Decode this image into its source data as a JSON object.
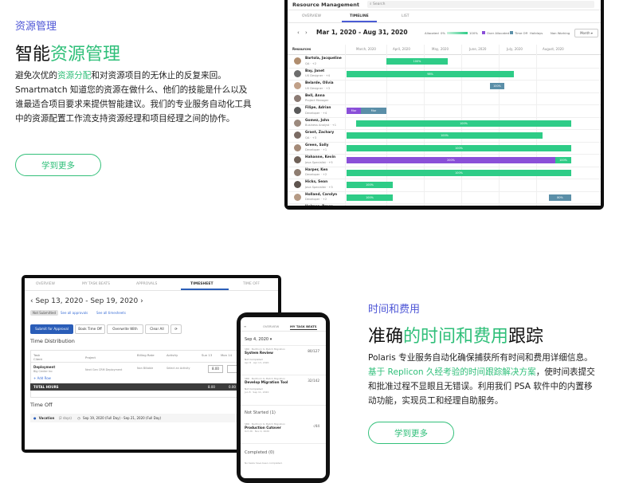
{
  "section1": {
    "label": "资源管理",
    "heading_pre": "智能",
    "heading_accent": "资源管理",
    "body_1": "避免次优的",
    "body_link": "资源分配",
    "body_2": "和对资源项目的无休止的反复来回。Smartmatch 知道您的资源在做什么、他们的技能是什么以及谁最适合项目要求来提供智能建议。我们的专业服务自动化工具中的资源配置工作流支持资源经理和项目经理之间的协作。",
    "button": "学到更多"
  },
  "section2": {
    "label": "时间和费用",
    "heading_pre": "准确",
    "heading_accent": "的时间和费用",
    "heading_post": "跟踪",
    "body_1": "Polaris 专业服务自动化确保捕获所有时间和费用详细信息。",
    "body_link": "基于 Replicon 久经考验的时间跟踪解决方案",
    "body_2": "，使时间表提交和批准过程不显眼且无错误。利用我们 PSA 软件中的内置移动功能，实现员工和经理自助服务。",
    "button": "学到更多"
  },
  "resource_app": {
    "title": "Resource Management",
    "search_placeholder": "Search",
    "tabs": [
      "OVERVIEW",
      "TIMELINE",
      "LIST"
    ],
    "date_range": "Mar 1, 2020 - Aug 31, 2020",
    "legend": [
      "Allocated",
      "0%",
      "100%",
      "Over Allocated",
      "Time Off",
      "Holidays",
      "Non Working"
    ],
    "view_select": "Month",
    "resources_label": "Resources",
    "months": [
      "March, 2020",
      "April, 2020",
      "May, 2020",
      "June, 2020",
      "July, 2020",
      "August, 2020"
    ],
    "rows": [
      {
        "name": "Bartola, Jacqueline",
        "role": "QA · +2"
      },
      {
        "name": "Bay, Janet",
        "role": "UX Designer · +4"
      },
      {
        "name": "Belarde, Olivia",
        "role": "UX Designer · +3"
      },
      {
        "name": "Bell, Anna",
        "role": "Project Manager"
      },
      {
        "name": "Filipe, Adrian",
        "role": "Developer · +4"
      },
      {
        "name": "Gomez, John",
        "role": "Business Analyst · +1"
      },
      {
        "name": "Grant, Zachary",
        "role": "QA · +3"
      },
      {
        "name": "Green, Sally",
        "role": "Developer · +1"
      },
      {
        "name": "Hahanne, Kevin",
        "role": "Java Specialist · +5"
      },
      {
        "name": "Harper, Ken",
        "role": "Developer · +2"
      },
      {
        "name": "Hicks, Sean",
        "role": "Java Specialist · +3"
      },
      {
        "name": "Holland, Carolyn",
        "role": "Developer · +2"
      },
      {
        "name": "Holmes, Bruce",
        "role": "Java Specialist"
      }
    ],
    "bar_labels": [
      "100%",
      "98%",
      "100%",
      "Mar",
      "Mar",
      "100%",
      "100%",
      "100%",
      "200%",
      "100%",
      "100%",
      "100%",
      "100%",
      "80%"
    ]
  },
  "timesheet_app": {
    "tabs": [
      "OVERVIEW",
      "MY TASK BEATS",
      "APPROVALS",
      "TIMESHEET",
      "TIME OFF"
    ],
    "date": "Sep 13, 2020 - Sep 19, 2020",
    "status": "Not Submitted",
    "links": [
      "See all approvals",
      "See all timesheets"
    ],
    "buttons": [
      "Submit for Approval",
      "Book Time Off",
      "Overwrite With",
      "Clear All"
    ],
    "time_dist_title": "Time Distribution",
    "col_heads": [
      "Task",
      "Project",
      "Billing Rate",
      "Activity",
      "Sun 13",
      "Mon 14"
    ],
    "task_client": "Client",
    "task_name": "Deployment",
    "task_client_name": "Big Center Inc",
    "project": "Next Gen CRM Deployment",
    "billing": "Non Billable",
    "activity": "Select an Activity",
    "hours": "8.00",
    "add_row": "+ Add Row",
    "total_label": "TOTAL HOURS",
    "total_1": "8.00",
    "total_2": "0.00",
    "time_off_title": "Time Off",
    "vacation": "Vacation",
    "vacation_days": "(2 days)",
    "vacation_range": "Sep 19, 2020 (Full Day) - Sep 21, 2020 (Full Day)"
  },
  "phone_app": {
    "tabs": [
      "OVERVIEW",
      "MY TASK BEATS"
    ],
    "date": "Sep 4, 2020",
    "items": [
      {
        "meta": "SBR · Berthom to Match Migration",
        "title": "System Review",
        "count": "80/127",
        "status": "Not Completed",
        "due": "Apr 8 · Apr 13, 2020"
      },
      {
        "meta": "SBR · Berthom to Match Migration",
        "title": "Develop Migration Tool",
        "count": "32/142",
        "status": "Not Completed",
        "due": "Jun 8 · Sep 11, 2020"
      }
    ],
    "not_started": "Not Started (1)",
    "item3": {
      "meta": "SBR · Berthom to Match Migration",
      "title": "Production Cutover",
      "count": "-/44",
      "due": "Oct 26 · Nov 4, 2020"
    },
    "completed": "Completed (0)",
    "empty": "No tasks have been completed."
  }
}
